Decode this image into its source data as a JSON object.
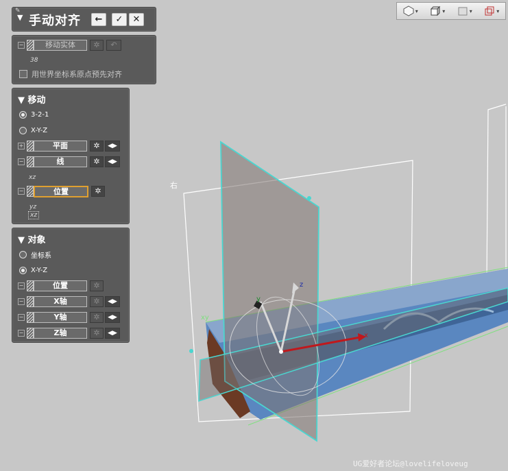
{
  "dialog": {
    "title": "手动对齐",
    "buttons": {
      "back": "←",
      "ok": "✓",
      "close": "✕"
    }
  },
  "move_body": {
    "field_label": "移动实体",
    "value": "38",
    "checkbox_label": "用世界坐标系原点预先对齐"
  },
  "move_section": {
    "heading": "移动",
    "radio_321": "3-2-1",
    "radio_xyz": "X-Y-Z",
    "plane_label": "平面",
    "line_label": "线",
    "line_sub": "xz",
    "position_label": "位置",
    "position_sub1": "yz",
    "position_sub2": "xz"
  },
  "object_section": {
    "heading": "对象",
    "radio_csys": "坐标系",
    "radio_xyz": "X-Y-Z",
    "position_label": "位置",
    "x_axis": "X轴",
    "y_axis": "Y轴",
    "z_axis": "Z轴"
  },
  "viewport": {
    "right_label": "右",
    "xy_label": "xy",
    "axis_x": "x",
    "axis_y": "y",
    "axis_z": "z",
    "watermark": "UG爱好者论坛@lovelifeloveug"
  },
  "colors": {
    "panel_bg": "#5a5a5a",
    "viewport_bg": "#c7c7c7",
    "highlight_plane": "#4ad6d0",
    "active_field_border": "#e0a030",
    "scan_blue": "#5a87c0"
  },
  "icons": [
    "pin-icon",
    "collapse-triangle-icon",
    "back-arrow-icon",
    "check-icon",
    "close-icon",
    "hatch-icon",
    "snowflake-icon",
    "double-arrow-icon",
    "view-style-icon"
  ]
}
